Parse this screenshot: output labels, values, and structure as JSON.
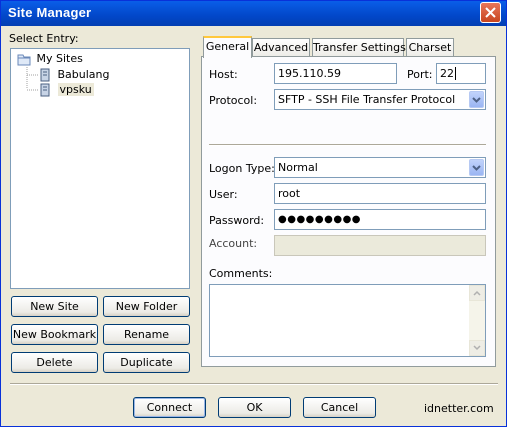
{
  "window": {
    "title": "Site Manager"
  },
  "tree": {
    "label": "Select Entry:",
    "root": "My Sites",
    "items": [
      "Babulang",
      "vpsku"
    ],
    "selected": "vpsku"
  },
  "left_buttons": {
    "new_site": "New Site",
    "new_folder": "New Folder",
    "new_bookmark": "New Bookmark",
    "rename": "Rename",
    "delete": "Delete",
    "duplicate": "Duplicate"
  },
  "tabs": [
    "General",
    "Advanced",
    "Transfer Settings",
    "Charset"
  ],
  "active_tab": "General",
  "general": {
    "host_label": "Host:",
    "host_value": "195.110.59",
    "port_label": "Port:",
    "port_value": "22",
    "protocol_label": "Protocol:",
    "protocol_value": "SFTP - SSH File Transfer Protocol",
    "logon_type_label": "Logon Type:",
    "logon_type_value": "Normal",
    "user_label": "User:",
    "user_value": "root",
    "password_label": "Password:",
    "password_value": "●●●●●●●●●",
    "account_label": "Account:",
    "account_value": "",
    "comments_label": "Comments:"
  },
  "footer": {
    "connect": "Connect",
    "ok": "OK",
    "cancel": "Cancel",
    "watermark": "idnetter.com"
  }
}
